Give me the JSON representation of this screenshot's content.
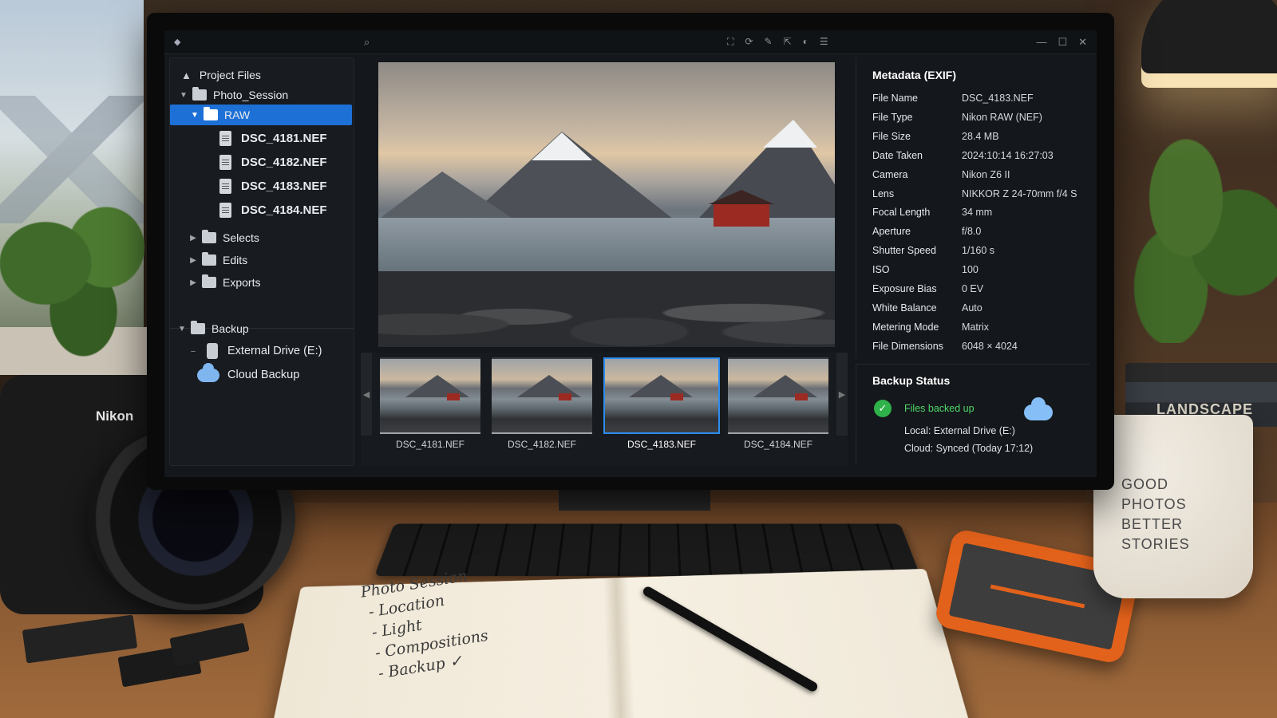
{
  "app": {
    "title": ""
  },
  "titlebar": {
    "window_controls": [
      "—",
      "☐",
      "✕"
    ],
    "tool_icons": [
      "crop-icon",
      "rotate-icon",
      "pen-icon",
      "export-icon",
      "compare-icon",
      "list-icon"
    ]
  },
  "tree": {
    "root": "Project Files",
    "session": "Photo_Session",
    "raw": "RAW",
    "files": [
      "DSC_4181.NEF",
      "DSC_4182.NEF",
      "DSC_4183.NEF",
      "DSC_4184.NEF"
    ],
    "folders": [
      "Selects",
      "Edits",
      "Exports"
    ],
    "backup": "Backup",
    "external": "External Drive (E:)",
    "cloud": "Cloud Backup"
  },
  "filmstrip": {
    "thumbs": [
      "DSC_4181.NEF",
      "DSC_4182.NEF",
      "DSC_4183.NEF",
      "DSC_4184.NEF"
    ],
    "selected": "DSC_4183.NEF"
  },
  "metadata": {
    "title": "Metadata (EXIF)",
    "rows": [
      {
        "k": "File Name",
        "v": "DSC_4183.NEF"
      },
      {
        "k": "File Type",
        "v": "Nikon RAW (NEF)"
      },
      {
        "k": "File Size",
        "v": "28.4 MB"
      },
      {
        "k": "Date Taken",
        "v": "2024:10:14 16:27:03"
      },
      {
        "k": "Camera",
        "v": "Nikon Z6 II"
      },
      {
        "k": "Lens",
        "v": "NIKKOR Z 24-70mm f/4 S"
      },
      {
        "k": "Focal Length",
        "v": "34 mm"
      },
      {
        "k": "Aperture",
        "v": "f/8.0"
      },
      {
        "k": "Shutter Speed",
        "v": "1/160 s"
      },
      {
        "k": "ISO",
        "v": "100"
      },
      {
        "k": "Exposure Bias",
        "v": "0 EV"
      },
      {
        "k": "White Balance",
        "v": "Auto"
      },
      {
        "k": "Metering Mode",
        "v": "Matrix"
      },
      {
        "k": "File Dimensions",
        "v": "6048 × 4024"
      }
    ]
  },
  "backup": {
    "title": "Backup Status",
    "status": "Files backed up",
    "local": "Local: External Drive (E:)",
    "cloud": "Cloud: Synced (Today 17:12)"
  },
  "scene": {
    "camera_brand": "Nikon",
    "books_label": "LANDSCAPE",
    "notebook_lines": [
      "Photo Session",
      "- Location",
      "- Light",
      "- Compositions",
      "- Backup ✓"
    ],
    "mug_lines": [
      "GOOD",
      "PHOTOS",
      "BETTER",
      "STORIES"
    ]
  },
  "colors": {
    "accent": "#1d70d6",
    "success": "#2fb24a",
    "selection_border": "#2d8cf0"
  }
}
